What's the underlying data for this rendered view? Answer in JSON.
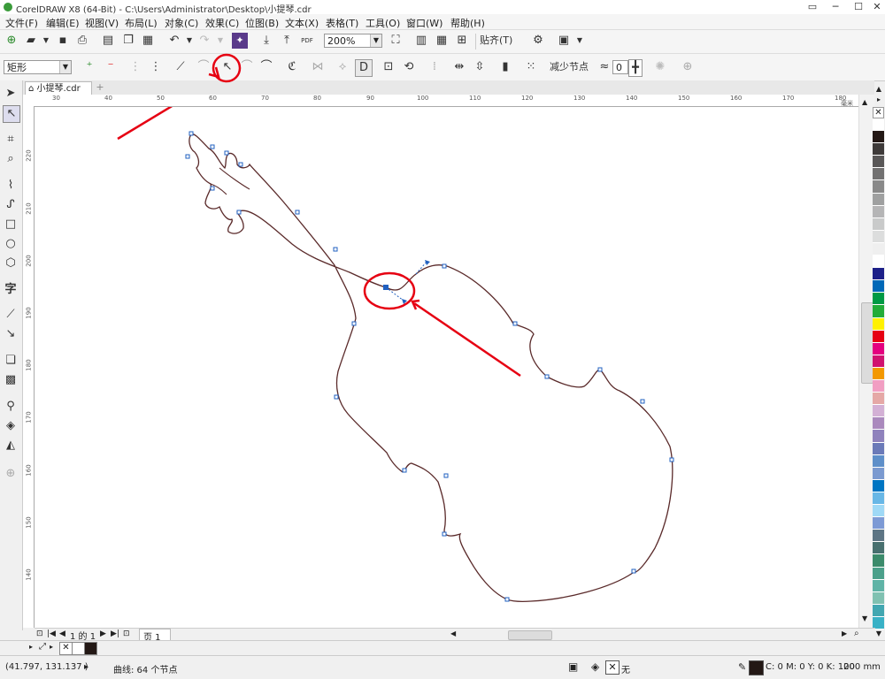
{
  "window": {
    "title": "CorelDRAW X8 (64-Bit) - C:\\Users\\Administrator\\Desktop\\小提琴.cdr"
  },
  "menu": [
    "文件(F)",
    "编辑(E)",
    "视图(V)",
    "布局(L)",
    "对象(C)",
    "效果(C)",
    "位图(B)",
    "文本(X)",
    "表格(T)",
    "工具(O)",
    "窗口(W)",
    "帮助(H)"
  ],
  "toolbar1": {
    "zoom": "200%",
    "snap": "贴齐(T)",
    "pdf": "PDF"
  },
  "toolbar2": {
    "shape_select": "矩形",
    "reduce_nodes": "减少节点",
    "smoothness": "0"
  },
  "tabs": {
    "doc": "小提琴.cdr"
  },
  "ruler_h": [
    "30",
    "40",
    "50",
    "60",
    "70",
    "80",
    "90",
    "100",
    "110",
    "120",
    "130",
    "140",
    "150",
    "160",
    "170",
    "180",
    "毫米"
  ],
  "ruler_v": [
    "220",
    "210",
    "200",
    "190",
    "180",
    "170",
    "160",
    "150",
    "140"
  ],
  "pagenav": {
    "page_of": "1 的 1",
    "page_tab": "页 1"
  },
  "status": {
    "coords": "(41.797, 131.137 )",
    "curve_info": "曲线: 64 个节点",
    "none": "无",
    "color": "C: 0 M: 0 Y: 0 K: 100",
    "outline": ".200 mm"
  },
  "palette_colors": [
    "#ffffff",
    "#231815",
    "#3e3a39",
    "#595757",
    "#727171",
    "#898989",
    "#9fa0a0",
    "#b5b5b6",
    "#c9caca",
    "#dcdddd",
    "#efefef",
    "#ffffff",
    "#1d2088",
    "#0068b7",
    "#009944",
    "#22ac38",
    "#fff100",
    "#e60012",
    "#e4007f",
    "#d0126f",
    "#f39800",
    "#f19ec2",
    "#e5a8a6",
    "#d3b0d5",
    "#aa89bd",
    "#8f82bc",
    "#6b7ab8",
    "#5e8fc9",
    "#7b9ad0",
    "#0075c2",
    "#68b7e6",
    "#9fd9f6",
    "#7d9ad5",
    "#5d7584",
    "#48706f",
    "#3b8b6b",
    "#4ba08a",
    "#5fb3a6",
    "#80c1b1",
    "#42a7b1",
    "#39b1c6"
  ],
  "annotations": {
    "color": "#e60012"
  }
}
